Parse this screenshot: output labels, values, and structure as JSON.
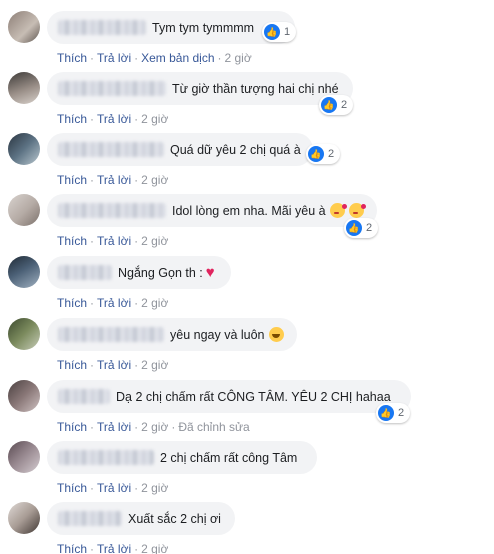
{
  "actions": {
    "like": "Thích",
    "reply": "Trả lời",
    "translate": "Xem bản dịch",
    "edited": "Đã chỉnh sửa",
    "separator": "·"
  },
  "colors": {
    "bubble": "#f2f3f5",
    "link": "#385898",
    "like_blue": "#1877f2",
    "heart": "#e0245e"
  },
  "comments": [
    {
      "text": "Tym tym tymmmm",
      "time": "2 giờ",
      "reactions": "1",
      "reaction_icon": "like-icon"
    },
    {
      "text": "Từ giờ thần tượng hai chị nhé",
      "time": "2 giờ",
      "reactions": "2",
      "reaction_icon": "like-icon"
    },
    {
      "text": "Quá dữ yêu 2 chị quá à",
      "time": "2 giờ",
      "reactions": "2",
      "reaction_icon": "like-icon"
    },
    {
      "text": "Idol lòng em nha. Mãi yêu à",
      "time": "2 giờ",
      "reactions": "2",
      "reaction_icon": "like-icon",
      "emoji": "kissing-face-icon"
    },
    {
      "text": "Ngắng Gọn th :",
      "time": "2 giờ",
      "emoji": "heart-icon"
    },
    {
      "text": "yêu ngay và luôn",
      "time": "2 giờ",
      "emoji": "grinning-face-icon"
    },
    {
      "text": "Dạ 2 chị chấm rất CÔNG TÂM. YÊU 2 CHỊ hahaa",
      "time": "2 giờ",
      "reactions": "2",
      "reaction_icon": "like-icon"
    },
    {
      "text": "2 chị chấm rất công Tâm",
      "time": "2 giờ"
    },
    {
      "text": "Xuất sắc 2 chị ơi",
      "time": "2 giờ"
    }
  ]
}
